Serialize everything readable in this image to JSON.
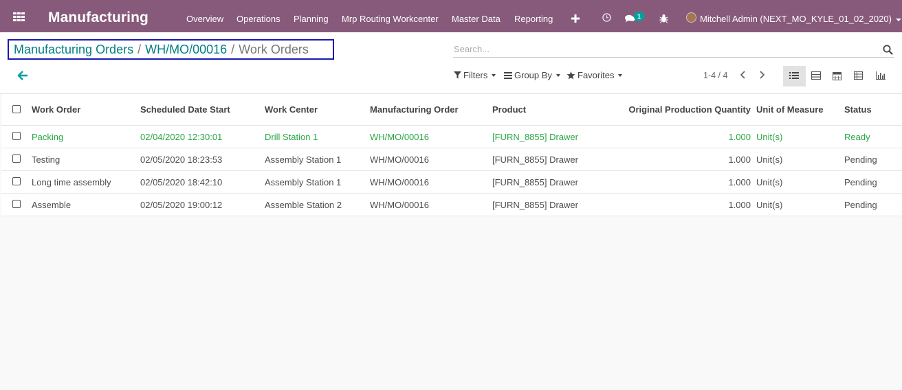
{
  "navbar": {
    "app_title": "Manufacturing",
    "menu": [
      "Overview",
      "Operations",
      "Planning",
      "Mrp Routing Workcenter",
      "Master Data",
      "Reporting"
    ],
    "icons": [
      "plus-icon",
      "clock-icon",
      "chat-icon",
      "bug-icon"
    ],
    "chat_badge": "1",
    "user_name": "Mitchell Admin (NEXT_MO_KYLE_01_02_2020)"
  },
  "breadcrumb": {
    "items": [
      "Manufacturing Orders",
      "WH/MO/00016"
    ],
    "current": "Work Orders",
    "separator": "/"
  },
  "search": {
    "placeholder": "Search..."
  },
  "filters": {
    "filters_label": "Filters",
    "group_by_label": "Group By",
    "favorites_label": "Favorites"
  },
  "pager": {
    "value": "1-4 / 4"
  },
  "views": {
    "active": "list",
    "items": [
      "list-view-icon",
      "kanban-view-icon",
      "calendar-view-icon",
      "pivot-view-icon",
      "graph-view-icon"
    ]
  },
  "table": {
    "headers": [
      "Work Order",
      "Scheduled Date Start",
      "Work Center",
      "Manufacturing Order",
      "Product",
      "Original Production Quantity",
      "Unit of Measure",
      "Status"
    ],
    "rows": [
      [
        "Packing",
        "02/04/2020 12:30:01",
        "Drill Station 1",
        "WH/MO/00016",
        "[FURN_8855] Drawer",
        "1.000",
        "Unit(s)",
        "Ready"
      ],
      [
        "Testing",
        "02/05/2020 18:23:53",
        "Assembly Station 1",
        "WH/MO/00016",
        "[FURN_8855] Drawer",
        "1.000",
        "Unit(s)",
        "Pending"
      ],
      [
        "Long time assembly",
        "02/05/2020 18:42:10",
        "Assembly Station 1",
        "WH/MO/00016",
        "[FURN_8855] Drawer",
        "1.000",
        "Unit(s)",
        "Pending"
      ],
      [
        "Assemble",
        "02/05/2020 19:00:12",
        "Assemble Station 2",
        "WH/MO/00016",
        "[FURN_8855] Drawer",
        "1.000",
        "Unit(s)",
        "Pending"
      ]
    ]
  },
  "colors": {
    "navbar": "#875a7b",
    "link": "#017e84",
    "ready": "#28a745",
    "badge": "#00a09d",
    "highlight_border": "#1919ae"
  }
}
